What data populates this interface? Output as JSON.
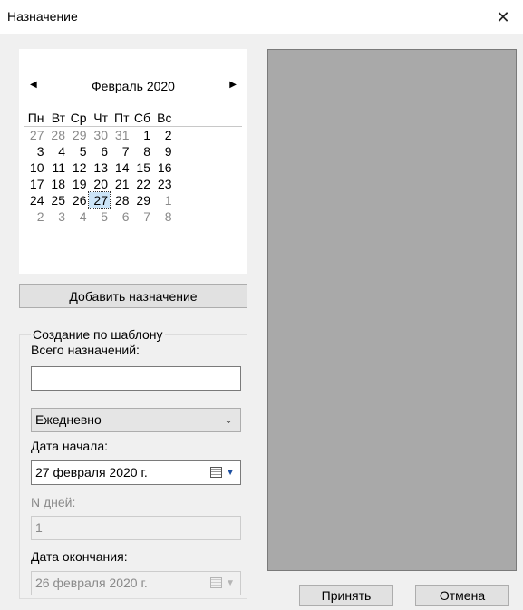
{
  "window": {
    "title": "Назначение",
    "close_symbol": "✕"
  },
  "calendar": {
    "month_label": "Февраль 2020",
    "prev_symbol": "◀",
    "next_symbol": "▶",
    "weekdays": [
      "Пн",
      "Вт",
      "Ср",
      "Чт",
      "Пт",
      "Сб",
      "Вс"
    ],
    "weeks": [
      [
        "27",
        "28",
        "29",
        "30",
        "31",
        "1",
        "2"
      ],
      [
        "3",
        "4",
        "5",
        "6",
        "7",
        "8",
        "9"
      ],
      [
        "10",
        "11",
        "12",
        "13",
        "14",
        "15",
        "16"
      ],
      [
        "17",
        "18",
        "19",
        "20",
        "21",
        "22",
        "23"
      ],
      [
        "24",
        "25",
        "26",
        "27",
        "28",
        "29",
        "1"
      ],
      [
        "2",
        "3",
        "4",
        "5",
        "6",
        "7",
        "8"
      ]
    ],
    "selected_day": "27"
  },
  "actions": {
    "add_label": "Добавить назначение"
  },
  "template_group": {
    "legend": "Создание по шаблону",
    "total_label": "Всего назначений:",
    "total_value": "",
    "frequency_value": "Ежедневно",
    "start_label": "Дата начала:",
    "start_value": "27 февраля  2020 г.",
    "ndays_label": "N дней:",
    "ndays_value": "1",
    "end_label": "Дата окончания:",
    "end_value": "26 февраля  2020 г."
  },
  "footer": {
    "accept_label": "Принять",
    "cancel_label": "Отмена"
  }
}
